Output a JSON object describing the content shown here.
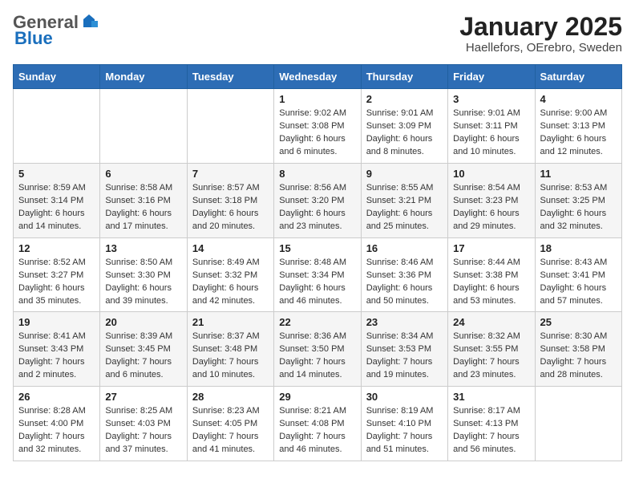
{
  "header": {
    "logo_general": "General",
    "logo_blue": "Blue",
    "month_title": "January 2025",
    "location": "Haellefors, OErebro, Sweden"
  },
  "days_of_week": [
    "Sunday",
    "Monday",
    "Tuesday",
    "Wednesday",
    "Thursday",
    "Friday",
    "Saturday"
  ],
  "weeks": [
    [
      {
        "num": "",
        "info": ""
      },
      {
        "num": "",
        "info": ""
      },
      {
        "num": "",
        "info": ""
      },
      {
        "num": "1",
        "info": "Sunrise: 9:02 AM\nSunset: 3:08 PM\nDaylight: 6 hours and 6 minutes."
      },
      {
        "num": "2",
        "info": "Sunrise: 9:01 AM\nSunset: 3:09 PM\nDaylight: 6 hours and 8 minutes."
      },
      {
        "num": "3",
        "info": "Sunrise: 9:01 AM\nSunset: 3:11 PM\nDaylight: 6 hours and 10 minutes."
      },
      {
        "num": "4",
        "info": "Sunrise: 9:00 AM\nSunset: 3:13 PM\nDaylight: 6 hours and 12 minutes."
      }
    ],
    [
      {
        "num": "5",
        "info": "Sunrise: 8:59 AM\nSunset: 3:14 PM\nDaylight: 6 hours and 14 minutes."
      },
      {
        "num": "6",
        "info": "Sunrise: 8:58 AM\nSunset: 3:16 PM\nDaylight: 6 hours and 17 minutes."
      },
      {
        "num": "7",
        "info": "Sunrise: 8:57 AM\nSunset: 3:18 PM\nDaylight: 6 hours and 20 minutes."
      },
      {
        "num": "8",
        "info": "Sunrise: 8:56 AM\nSunset: 3:20 PM\nDaylight: 6 hours and 23 minutes."
      },
      {
        "num": "9",
        "info": "Sunrise: 8:55 AM\nSunset: 3:21 PM\nDaylight: 6 hours and 25 minutes."
      },
      {
        "num": "10",
        "info": "Sunrise: 8:54 AM\nSunset: 3:23 PM\nDaylight: 6 hours and 29 minutes."
      },
      {
        "num": "11",
        "info": "Sunrise: 8:53 AM\nSunset: 3:25 PM\nDaylight: 6 hours and 32 minutes."
      }
    ],
    [
      {
        "num": "12",
        "info": "Sunrise: 8:52 AM\nSunset: 3:27 PM\nDaylight: 6 hours and 35 minutes."
      },
      {
        "num": "13",
        "info": "Sunrise: 8:50 AM\nSunset: 3:30 PM\nDaylight: 6 hours and 39 minutes."
      },
      {
        "num": "14",
        "info": "Sunrise: 8:49 AM\nSunset: 3:32 PM\nDaylight: 6 hours and 42 minutes."
      },
      {
        "num": "15",
        "info": "Sunrise: 8:48 AM\nSunset: 3:34 PM\nDaylight: 6 hours and 46 minutes."
      },
      {
        "num": "16",
        "info": "Sunrise: 8:46 AM\nSunset: 3:36 PM\nDaylight: 6 hours and 50 minutes."
      },
      {
        "num": "17",
        "info": "Sunrise: 8:44 AM\nSunset: 3:38 PM\nDaylight: 6 hours and 53 minutes."
      },
      {
        "num": "18",
        "info": "Sunrise: 8:43 AM\nSunset: 3:41 PM\nDaylight: 6 hours and 57 minutes."
      }
    ],
    [
      {
        "num": "19",
        "info": "Sunrise: 8:41 AM\nSunset: 3:43 PM\nDaylight: 7 hours and 2 minutes."
      },
      {
        "num": "20",
        "info": "Sunrise: 8:39 AM\nSunset: 3:45 PM\nDaylight: 7 hours and 6 minutes."
      },
      {
        "num": "21",
        "info": "Sunrise: 8:37 AM\nSunset: 3:48 PM\nDaylight: 7 hours and 10 minutes."
      },
      {
        "num": "22",
        "info": "Sunrise: 8:36 AM\nSunset: 3:50 PM\nDaylight: 7 hours and 14 minutes."
      },
      {
        "num": "23",
        "info": "Sunrise: 8:34 AM\nSunset: 3:53 PM\nDaylight: 7 hours and 19 minutes."
      },
      {
        "num": "24",
        "info": "Sunrise: 8:32 AM\nSunset: 3:55 PM\nDaylight: 7 hours and 23 minutes."
      },
      {
        "num": "25",
        "info": "Sunrise: 8:30 AM\nSunset: 3:58 PM\nDaylight: 7 hours and 28 minutes."
      }
    ],
    [
      {
        "num": "26",
        "info": "Sunrise: 8:28 AM\nSunset: 4:00 PM\nDaylight: 7 hours and 32 minutes."
      },
      {
        "num": "27",
        "info": "Sunrise: 8:25 AM\nSunset: 4:03 PM\nDaylight: 7 hours and 37 minutes."
      },
      {
        "num": "28",
        "info": "Sunrise: 8:23 AM\nSunset: 4:05 PM\nDaylight: 7 hours and 41 minutes."
      },
      {
        "num": "29",
        "info": "Sunrise: 8:21 AM\nSunset: 4:08 PM\nDaylight: 7 hours and 46 minutes."
      },
      {
        "num": "30",
        "info": "Sunrise: 8:19 AM\nSunset: 4:10 PM\nDaylight: 7 hours and 51 minutes."
      },
      {
        "num": "31",
        "info": "Sunrise: 8:17 AM\nSunset: 4:13 PM\nDaylight: 7 hours and 56 minutes."
      },
      {
        "num": "",
        "info": ""
      }
    ]
  ]
}
